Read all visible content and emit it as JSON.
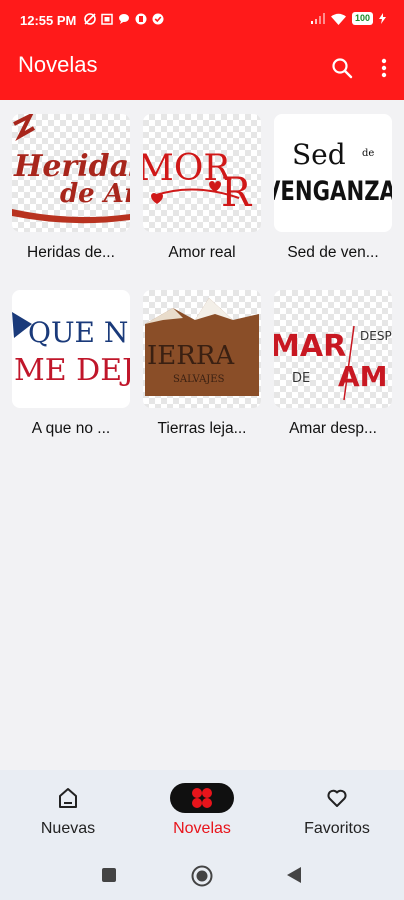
{
  "status": {
    "time": "12:55 PM",
    "battery": "100"
  },
  "appbar": {
    "title": "Novelas"
  },
  "grid": [
    {
      "label": "Heridas de..."
    },
    {
      "label": "Amor real"
    },
    {
      "label": "Sed de ven..."
    },
    {
      "label": "A que no ..."
    },
    {
      "label": "Tierras leja..."
    },
    {
      "label": "Amar desp..."
    }
  ],
  "thumbs": {
    "heridas": {
      "line1": "Heridas",
      "line2": "de An"
    },
    "amor": {
      "line1": "MOR",
      "line2": "R"
    },
    "sed": {
      "line1": "Sed",
      "small": "de",
      "line2": "VENGANZA"
    },
    "queno": {
      "line1": "QUE N",
      "line2": "ME DEJA"
    },
    "tierras": {
      "line1": "IERRA",
      "line2": "SALVAJES"
    },
    "amar": {
      "line1": "MAR",
      "line2": "DE AM",
      "side": "DESP"
    }
  },
  "bottom_nav": [
    {
      "label": "Nuevas"
    },
    {
      "label": "Novelas"
    },
    {
      "label": "Favoritos"
    }
  ],
  "colors": {
    "primary": "#ff1a1a",
    "active": "#e8141b"
  }
}
